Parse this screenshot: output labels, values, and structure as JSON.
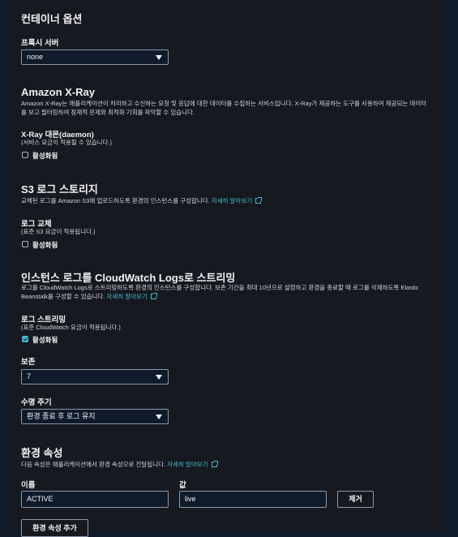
{
  "container_options": {
    "title": "컨테이너 옵션",
    "proxy_label": "프록시 서버",
    "proxy_value": "none"
  },
  "xray": {
    "title": "Amazon X-Ray",
    "desc_line1": "Amazon X-Ray는 애플리케이션이 처리하고 수신하는 요청 및 응답에 대한 데이터를 수집하는 서비스입니다. X-Ray가 제공하는 도구를 사용하여 제공되는 데이터",
    "desc_line2": "를 보고 필터링하여 잠재적 문제와 최적화 기회를 파악할 수 있습니다.",
    "daemon_label": "X-Ray 대몬(daemon)",
    "daemon_note": "(서비스 요금이 적용될 수 있습니다.)",
    "enabled_label": "활성화됨",
    "enabled": false
  },
  "s3": {
    "title": "S3 로그 스토리지",
    "desc": "교체된 로그를 Amazon S3에 업로드하도록 환경의 인스턴스를 구성합니다.",
    "learn_more": "자세히 알아보기",
    "rotation_label": "로그 교체",
    "rotation_note": "(표준 S3 요금이 적용됩니다.)",
    "enabled_label": "활성화됨",
    "enabled": false
  },
  "cloudwatch": {
    "title": "인스턴스 로그를 CloudWatch Logs로 스트리밍",
    "desc_line1": "로그를 CloudWatch Logs로 스트리밍하도록 환경의 인스턴스를 구성합니다. 보존 기간을 최대 10년으로 설정하고 환경을 종료할 때 로그를 삭제하도록 Elastic",
    "desc_line2": "Beanstalk를 구성할 수 있습니다.",
    "learn_more": "자세히 알아보기",
    "streaming_label": "로그 스트리밍",
    "streaming_note": "(표준 CloudWatch 요금이 적용됩니다.)",
    "enabled_label": "활성화됨",
    "enabled": true,
    "retention_label": "보존",
    "retention_value": "7",
    "lifecycle_label": "수명 주기",
    "lifecycle_value": "환경 종료 후 로그 유지"
  },
  "env_props": {
    "title": "환경 속성",
    "desc": "다음 속성은 애플리케이션에서 환경 속성으로 전달됩니다.",
    "learn_more": "자세히 알아보기",
    "name_label": "이름",
    "value_label": "값",
    "name_value": "ACTIVE",
    "value_value": "live",
    "remove_label": "제거",
    "add_label": "환경 속성 추가"
  },
  "colors": {
    "background": "#0f1b2a",
    "panel": "#16191f",
    "link": "#44b9d6",
    "text": "#f2f3f3"
  }
}
